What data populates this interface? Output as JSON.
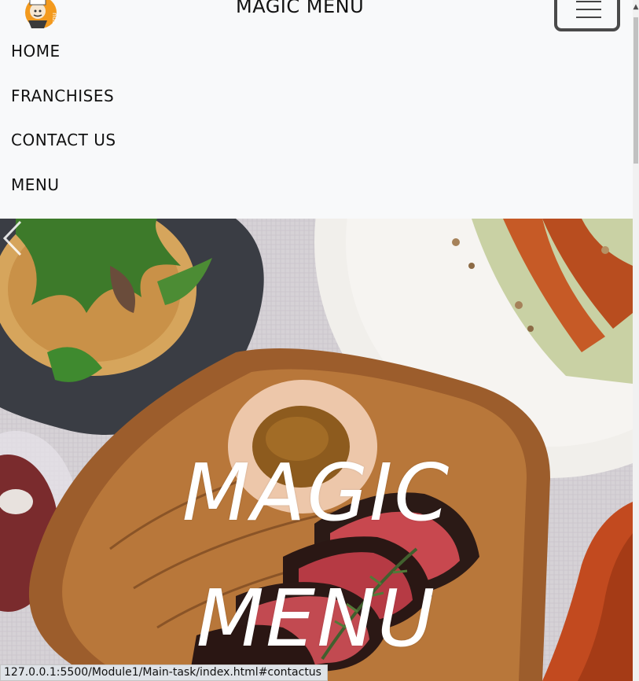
{
  "navbar": {
    "brand": "MAGIC MENU",
    "logo_icon": "chef-logo-icon",
    "toggler_icon": "hamburger-menu-icon",
    "items": [
      {
        "label": "HOME"
      },
      {
        "label": "FRANCHISES"
      },
      {
        "label": "CONTACT US"
      },
      {
        "label": "MENU"
      }
    ]
  },
  "hero": {
    "line1": "MAGIC",
    "line2": "MENU",
    "prev_icon": "chevron-left-icon"
  },
  "status_bar": {
    "url": "127.0.0.1:5500/Module1/Main-task/index.html#contactus"
  },
  "colors": {
    "navbar_bg": "#f8f9fa",
    "hero_text": "#ffffff"
  }
}
